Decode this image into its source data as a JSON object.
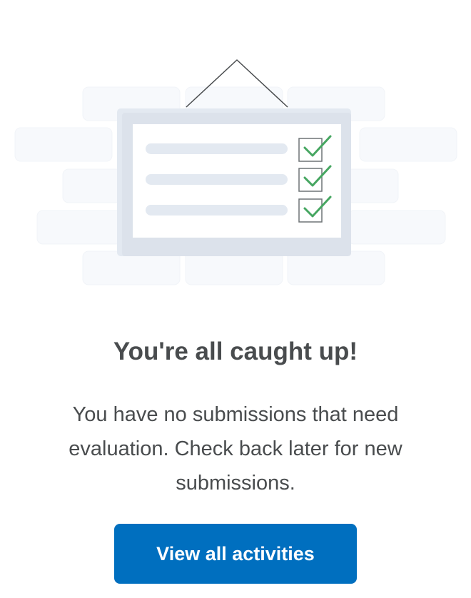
{
  "empty_state": {
    "title": "You're all caught up!",
    "message": "You have no submissions that need evaluation. Check back later for new submissions.",
    "action_label": "View all activities"
  },
  "colors": {
    "primary": "#006fbf",
    "text": "#494c4e",
    "check": "#46a661"
  }
}
